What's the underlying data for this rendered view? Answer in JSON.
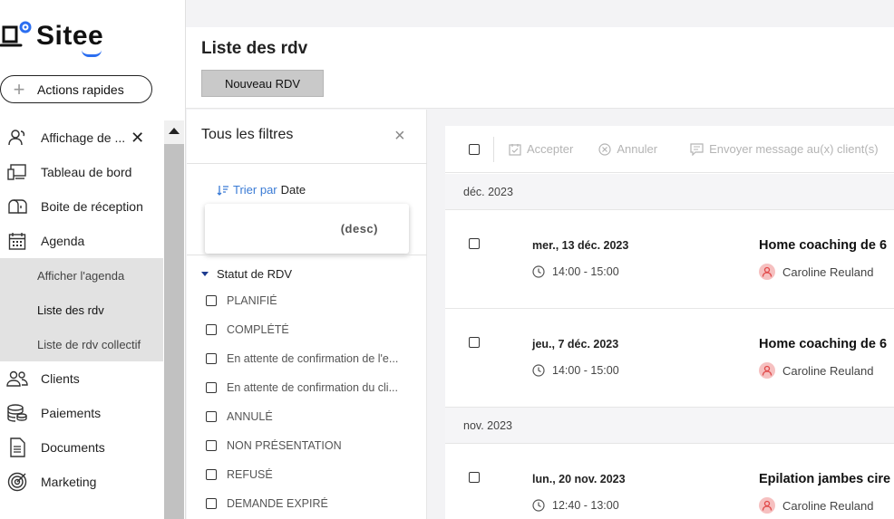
{
  "app": {
    "logo_text": "Sitee",
    "brand_color": "#2b6ef0"
  },
  "sidebar": {
    "quick_actions_label": "Actions rapides",
    "items": [
      {
        "label": "Affichage de ...",
        "icon": "users-display-icon",
        "closable": true
      },
      {
        "label": "Tableau de bord",
        "icon": "dashboard-icon"
      },
      {
        "label": "Boite de réception",
        "icon": "mailbox-icon"
      },
      {
        "label": "Agenda",
        "icon": "calendar-icon"
      }
    ],
    "agenda_sub": [
      {
        "label": "Afficher l'agenda"
      },
      {
        "label": "Liste des rdv",
        "active": true
      },
      {
        "label": "Liste de rdv collectif"
      }
    ],
    "items_after": [
      {
        "label": "Clients",
        "icon": "clients-icon"
      },
      {
        "label": "Paiements",
        "icon": "coins-icon"
      },
      {
        "label": "Documents",
        "icon": "document-icon"
      },
      {
        "label": "Marketing",
        "icon": "marketing-icon"
      }
    ]
  },
  "header": {
    "title": "Liste des rdv",
    "new_button": "Nouveau RDV"
  },
  "filters": {
    "title": "Tous les filtres",
    "sort_label": "Trier par",
    "sort_value": "Date",
    "sort_order": "(desc)",
    "status_title": "Statut de RDV",
    "statuses": [
      "PLANIFIÉ",
      "COMPLÉTÉ",
      "En attente de confirmation de l'e...",
      "En attente de confirmation du cli...",
      "ANNULÉ",
      "NON PRÉSENTATION",
      "REFUSÉ",
      "DEMANDE EXPIRÉ"
    ]
  },
  "toolbar": {
    "accept": "Accepter",
    "cancel": "Annuler",
    "message": "Envoyer message au(x) client(s)"
  },
  "groups": [
    {
      "month": "déc. 2023",
      "appointments": [
        {
          "date": "mer., 13 déc. 2023",
          "time": "14:00 - 15:00",
          "service": "Home coaching de 6",
          "client": "Caroline Reuland"
        },
        {
          "date": "jeu., 7 déc. 2023",
          "time": "14:00 - 15:00",
          "service": "Home coaching de 6",
          "client": "Caroline Reuland"
        }
      ]
    },
    {
      "month": "nov. 2023",
      "appointments": [
        {
          "date": "lun., 20 nov. 2023",
          "time": "12:40 - 13:00",
          "service": "Epilation jambes cire",
          "client": "Caroline Reuland"
        }
      ]
    }
  ]
}
